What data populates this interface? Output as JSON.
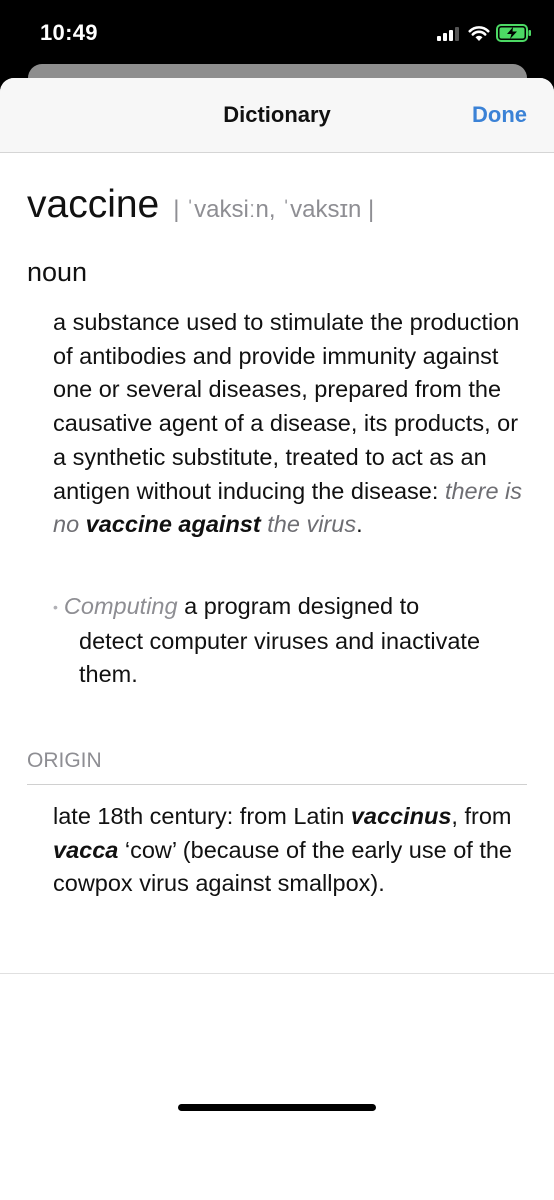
{
  "status_bar": {
    "time": "10:49"
  },
  "nav": {
    "title": "Dictionary",
    "done_label": "Done"
  },
  "entry": {
    "headword": "vaccine",
    "pronunciation": "| ˈvaksiːn, ˈvaksɪn |",
    "part_of_speech": "noun",
    "definition": "a substance used to stimulate the production of antibodies and provide immunity against one or several diseases, prepared from the causative agent of a disease, its products, or a synthetic substitute, treated to act as an antigen without inducing the disease:",
    "example": {
      "lead": "there is no",
      "bold": "vaccine against",
      "tail": "the virus",
      "end": "."
    },
    "sense2": {
      "bullet": "•",
      "domain": "Computing",
      "first": "a program designed to",
      "rest": "detect computer viruses and inactivate them."
    }
  },
  "origin": {
    "label": "ORIGIN",
    "t1": "late 18th century: from Latin",
    "w1": "vaccinus",
    "t2": ",",
    "t3": "from",
    "w2": "vacca",
    "w3": "‘cow’",
    "t4": "(because of the early use of the cowpox virus against smallpox)."
  }
}
